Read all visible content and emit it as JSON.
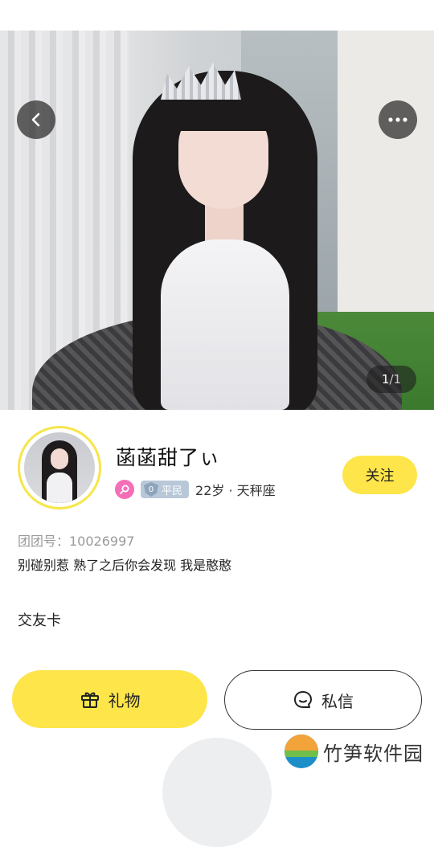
{
  "photo": {
    "counter_current": "1",
    "counter_total": "/1"
  },
  "nav": {
    "back_icon": "chevron-left-icon",
    "more_icon": "more-dots-icon"
  },
  "profile": {
    "nickname": "菡菡甜了ぃ",
    "rank": "平民",
    "rank_level": "0",
    "age_zodiac": "22岁 · 天秤座",
    "follow_label": "关注",
    "uid": "团团号：10026997",
    "bio": "别碰别惹 熟了之后你会发现 我是憨憨"
  },
  "sections": {
    "friend_card": "交友卡"
  },
  "actions": {
    "gift_label": "礼物",
    "message_label": "私信"
  },
  "watermark": {
    "text": "竹笋软件园"
  },
  "colors": {
    "accent_yellow": "#fde54a",
    "female_pink": "#f46fb7",
    "rank_gray_blue": "#b9c8d8"
  }
}
